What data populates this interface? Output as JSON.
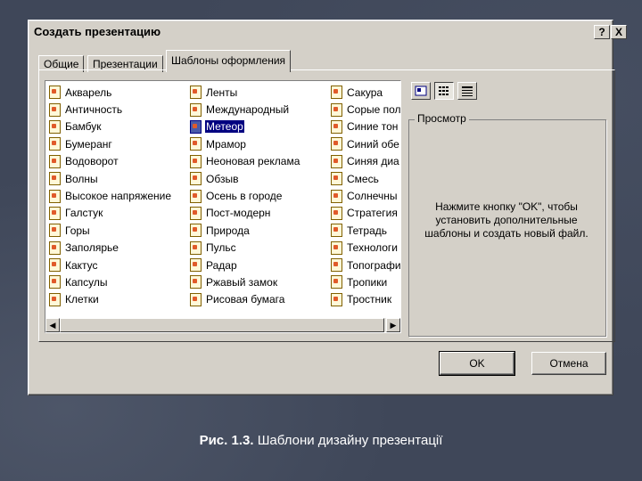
{
  "dialog": {
    "title": "Создать презентацию",
    "help_button": "?",
    "close_button": "X"
  },
  "tabs": [
    {
      "label": "Общие"
    },
    {
      "label": "Презентации"
    },
    {
      "label": "Шаблоны оформления"
    }
  ],
  "templates": {
    "column1": [
      "Акварель",
      "Античность",
      "Бамбук",
      "Бумеранг",
      "Водоворот",
      "Волны",
      "Высокое напряжение",
      "Галстук",
      "Горы",
      "Заполярье",
      "Кактус",
      "Капсулы",
      "Клетки"
    ],
    "column2": [
      "Ленты",
      "Международный",
      "Метеор",
      "Мрамор",
      "Неоновая реклама",
      "Обзыв",
      "Осень в городе",
      "Пост-модерн",
      "Природа",
      "Пульс",
      "Радар",
      "Ржавый замок",
      "Рисовая бумага"
    ],
    "column3": [
      "Сакура",
      "Сорые пол",
      "Синие тон",
      "Синий обе",
      "Синяя диа",
      "Смесь",
      "Солнечны",
      "Стратегия",
      "Тетрадь",
      "Технологи",
      "Топографи",
      "Тропики",
      "Тростник"
    ],
    "selected": "Метеор"
  },
  "view_buttons": [
    "large-icons",
    "list",
    "details"
  ],
  "preview": {
    "legend": "Просмотр",
    "message": "Нажмите кнопку \"OK\", чтобы установить дополнительные шаблоны и создать новый файл."
  },
  "buttons": {
    "ok": "OK",
    "cancel": "Отмена"
  },
  "caption": {
    "prefix": "Рис. 1.3.",
    "text": "Шаблони дизайну презентації"
  }
}
